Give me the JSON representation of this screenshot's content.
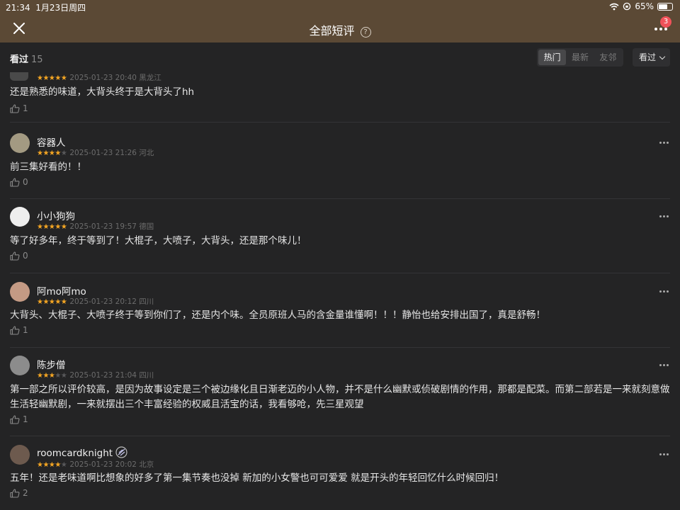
{
  "status": {
    "time": "21:34",
    "date": "1月23日周四",
    "battery": "65%",
    "battery_level": 0.65
  },
  "nav": {
    "title": "全部短评",
    "help_icon_label": "?",
    "badge": "3"
  },
  "filter": {
    "label": "看过",
    "count": "15",
    "tabs": [
      {
        "label": "热门",
        "active": true
      },
      {
        "label": "最新",
        "active": false
      },
      {
        "label": "友邻",
        "active": false
      }
    ],
    "sort_label": "看过"
  },
  "comments": [
    {
      "name": "",
      "rating": 5,
      "date": "2025-01-23 20:40",
      "location": "黑龙江",
      "text": "还是熟悉的味道，大背头终于是大背头了hh",
      "likes": "1",
      "avatar_color": "#4a4a4a"
    },
    {
      "name": "容器人",
      "rating": 4,
      "date": "2025-01-23 21:26",
      "location": "河北",
      "text": "前三集好看的！！",
      "likes": "0",
      "avatar_color": "#a39a82"
    },
    {
      "name": "小小狗狗",
      "rating": 5,
      "date": "2025-01-23 19:57",
      "location": "德国",
      "text": "等了好多年，终于等到了！大棍子，大喷子，大背头，还是那个味儿！",
      "likes": "0",
      "avatar_color": "#eeeeee"
    },
    {
      "name": "阿mo阿mo",
      "rating": 5,
      "date": "2025-01-23 20:12",
      "location": "四川",
      "text": "大背头、大棍子、大喷子终于等到你们了，还是内个味。全员原班人马的含金量谁懂啊！！！静怡也给安排出国了，真是舒畅！",
      "likes": "1",
      "avatar_color": "#c49a84"
    },
    {
      "name": "陈步僧",
      "rating": 3,
      "date": "2025-01-23 21:04",
      "location": "四川",
      "text": "第一部之所以评价较高，是因为故事设定是三个被边缘化且日渐老迈的小人物，并不是什么幽默或侦破剧情的作用，那都是配菜。而第二部若是一来就刻意做生活轻幽默剧，一来就摆出三个丰富经验的权威且活宝的话，我看够呛，先三星观望",
      "likes": "1",
      "avatar_color": "#8c8c8c"
    },
    {
      "name": "roomcardknight",
      "rating": 4,
      "date": "2025-01-23 20:02",
      "location": "北京",
      "text": "五年！还是老味道啊比想象的好多了第一集节奏也没掉 新加的小女警也可可爱爱 就是开头的年轻回忆什么时候回归！",
      "likes": "2",
      "avatar_color": "#6d5a4e"
    }
  ]
}
